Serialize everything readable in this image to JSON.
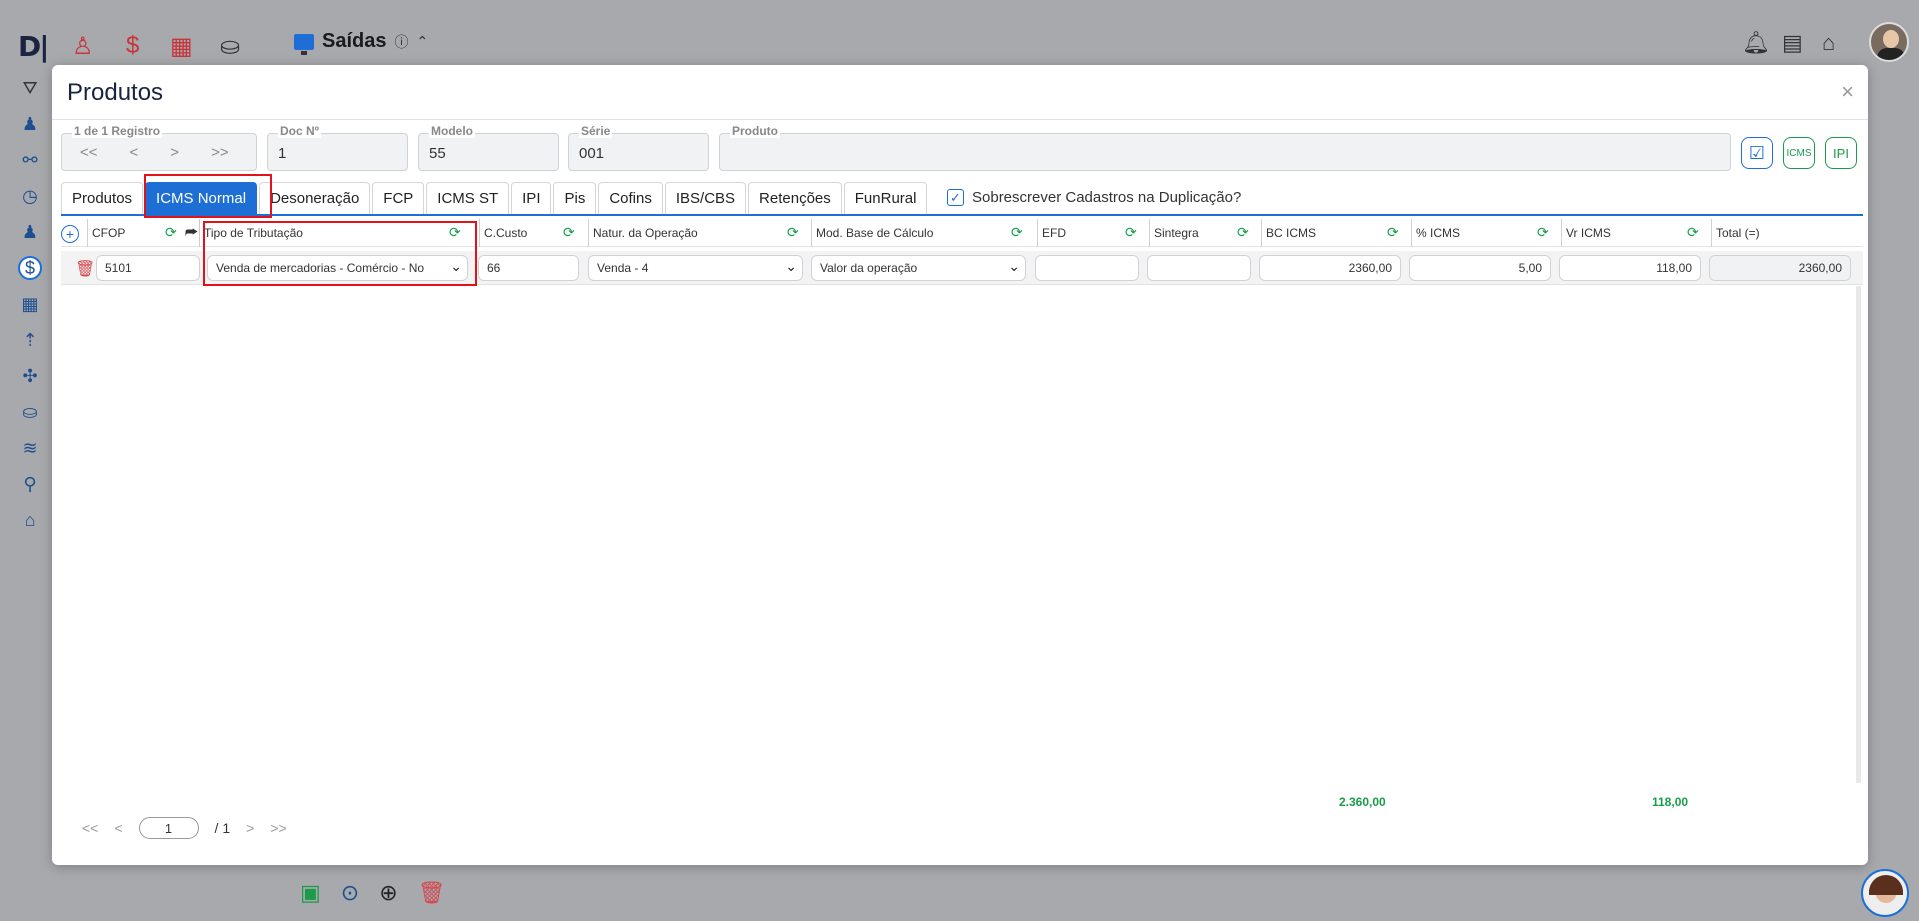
{
  "app": {
    "logo": "D|",
    "title": "Saídas"
  },
  "modal": {
    "title": "Produtos",
    "close": "×"
  },
  "record_nav": {
    "legend": "1 de 1 Registro",
    "first": "<<",
    "prev": "<",
    "next": ">",
    "last": ">>"
  },
  "fields": {
    "doc_label": "Doc Nº",
    "doc_value": "1",
    "modelo_label": "Modelo",
    "modelo_value": "55",
    "serie_label": "Série",
    "serie_value": "001",
    "produto_label": "Produto",
    "produto_value": ""
  },
  "action_buttons": {
    "check": "☑",
    "icms": "ICMS",
    "ipi": "IPI"
  },
  "tabs": [
    {
      "label": "Produtos",
      "active": false
    },
    {
      "label": "ICMS Normal",
      "active": true
    },
    {
      "label": "Desoneração",
      "active": false
    },
    {
      "label": "FCP",
      "active": false
    },
    {
      "label": "ICMS ST",
      "active": false
    },
    {
      "label": "IPI",
      "active": false
    },
    {
      "label": "Pis",
      "active": false
    },
    {
      "label": "Cofins",
      "active": false
    },
    {
      "label": "IBS/CBS",
      "active": false
    },
    {
      "label": "Retenções",
      "active": false
    },
    {
      "label": "FunRural",
      "active": false
    }
  ],
  "overwrite": {
    "checked": true,
    "label": "Sobrescrever Cadastros na Duplicação?"
  },
  "grid": {
    "columns": [
      "CFOP",
      "Tipo de Tributação",
      "C.Custo",
      "Natur. da Operação",
      "Mod. Base de Cálculo",
      "EFD",
      "Sintegra",
      "BC ICMS",
      "% ICMS",
      "Vr ICMS",
      "Total (=)"
    ],
    "row": {
      "cfop": "5101",
      "tipo_tributacao": "Venda de mercadorias - Comércio - No",
      "c_custo": "66",
      "natur_operacao": "Venda - 4",
      "mod_base_calculo": "Valor da operação",
      "efd": "",
      "sintegra": "",
      "bc_icms": "2360,00",
      "pct_icms": "5,00",
      "vr_icms": "118,00",
      "total": "2360,00"
    }
  },
  "totals": {
    "bc_icms": "2.360,00",
    "vr_icms": "118,00"
  },
  "pager": {
    "first": "<<",
    "prev": "<",
    "current": "1",
    "total": "/ 1",
    "next": ">",
    "last": ">>"
  }
}
